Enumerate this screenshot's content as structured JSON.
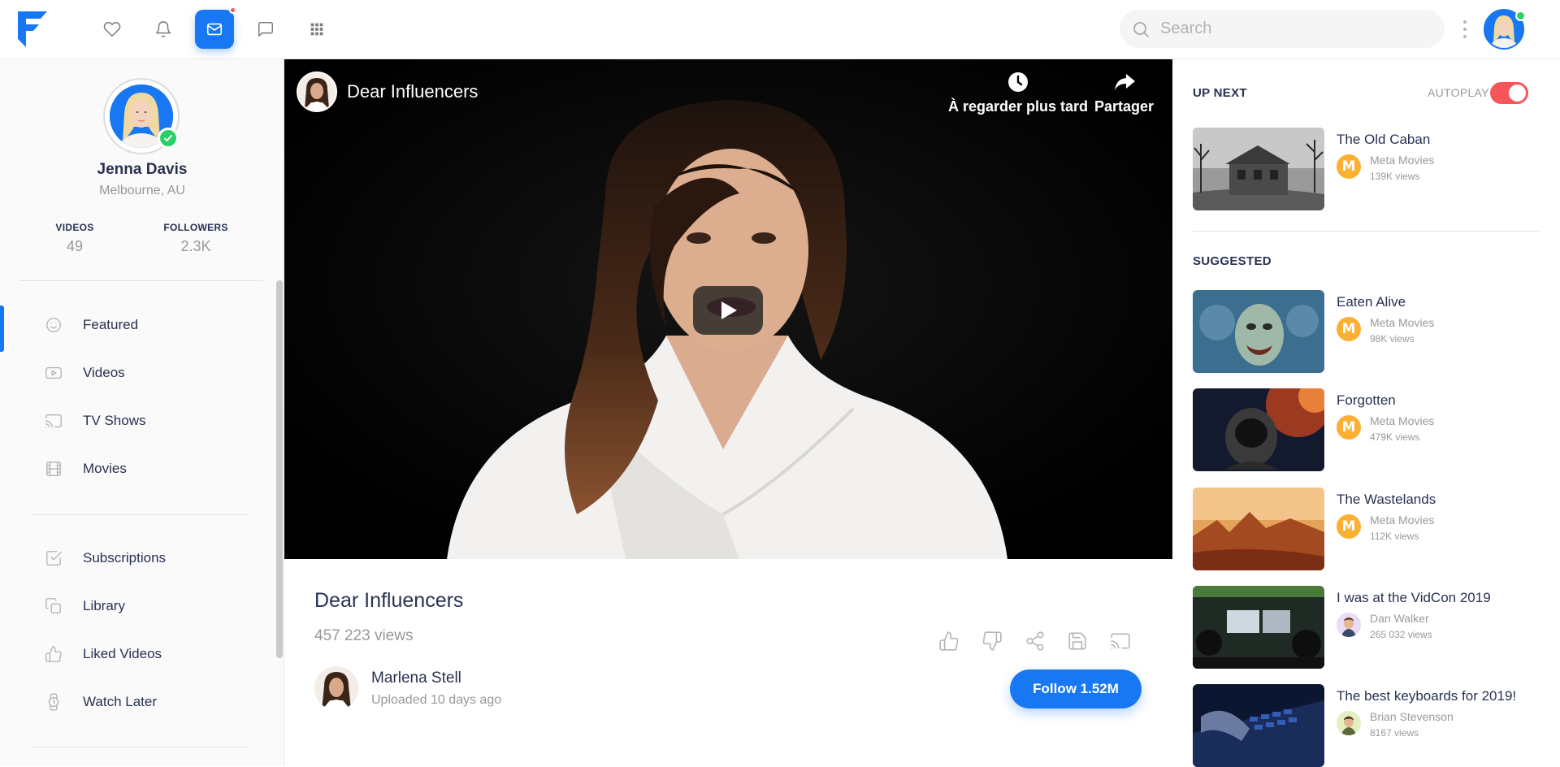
{
  "nav": {
    "search_placeholder": "Search",
    "icons": [
      "heart-icon",
      "bell-icon",
      "mail-icon",
      "chat-icon",
      "apps-grid-icon"
    ],
    "active_icon": "mail-icon",
    "accent_color": "#1877f2",
    "notification_color": "#f8555a"
  },
  "profile": {
    "name": "Jenna Davis",
    "location": "Melbourne, AU",
    "videos_label": "VIDEOS",
    "videos_value": "49",
    "followers_label": "FOLLOWERS",
    "followers_value": "2.3K"
  },
  "sidebar": {
    "items": [
      {
        "label": "Featured",
        "icon": "smile-icon",
        "active": true
      },
      {
        "label": "Videos",
        "icon": "play-square-icon"
      },
      {
        "label": "TV Shows",
        "icon": "cast-icon"
      },
      {
        "label": "Movies",
        "icon": "film-icon"
      },
      {
        "label": "Subscriptions",
        "icon": "check-square-icon"
      },
      {
        "label": "Library",
        "icon": "copy-icon"
      },
      {
        "label": "Liked Videos",
        "icon": "thumbs-up-icon"
      },
      {
        "label": "Watch Later",
        "icon": "watch-icon"
      }
    ]
  },
  "video": {
    "overlay_title": "Dear Influencers",
    "watch_later_label": "À regarder plus tard",
    "share_label": "Partager",
    "title": "Dear Influencers",
    "views": "457 223 views",
    "uploader_name": "Marlena Stell",
    "uploaded": "Uploaded 10 days ago",
    "follow_label": "Follow 1.52M"
  },
  "right": {
    "up_next_label": "UP NEXT",
    "autoplay_label": "AUTOPLAY",
    "autoplay_on": true,
    "suggested_label": "SUGGESTED",
    "up_next": {
      "title": "The Old Caban",
      "author": "Meta Movies",
      "views": "139K views",
      "avatar": "M"
    },
    "suggested": [
      {
        "title": "Eaten Alive",
        "author": "Meta Movies",
        "views": "98K views",
        "avatar": "M"
      },
      {
        "title": "Forgotten",
        "author": "Meta Movies",
        "views": "479K views",
        "avatar": "M"
      },
      {
        "title": "The Wastelands",
        "author": "Meta Movies",
        "views": "112K views",
        "avatar": "M"
      },
      {
        "title": "I was at the VidCon 2019",
        "author": "Dan Walker",
        "views": "265 032 views"
      },
      {
        "title": "The best keyboards for 2019!",
        "author": "Brian Stevenson",
        "views": "8167 views"
      }
    ]
  }
}
